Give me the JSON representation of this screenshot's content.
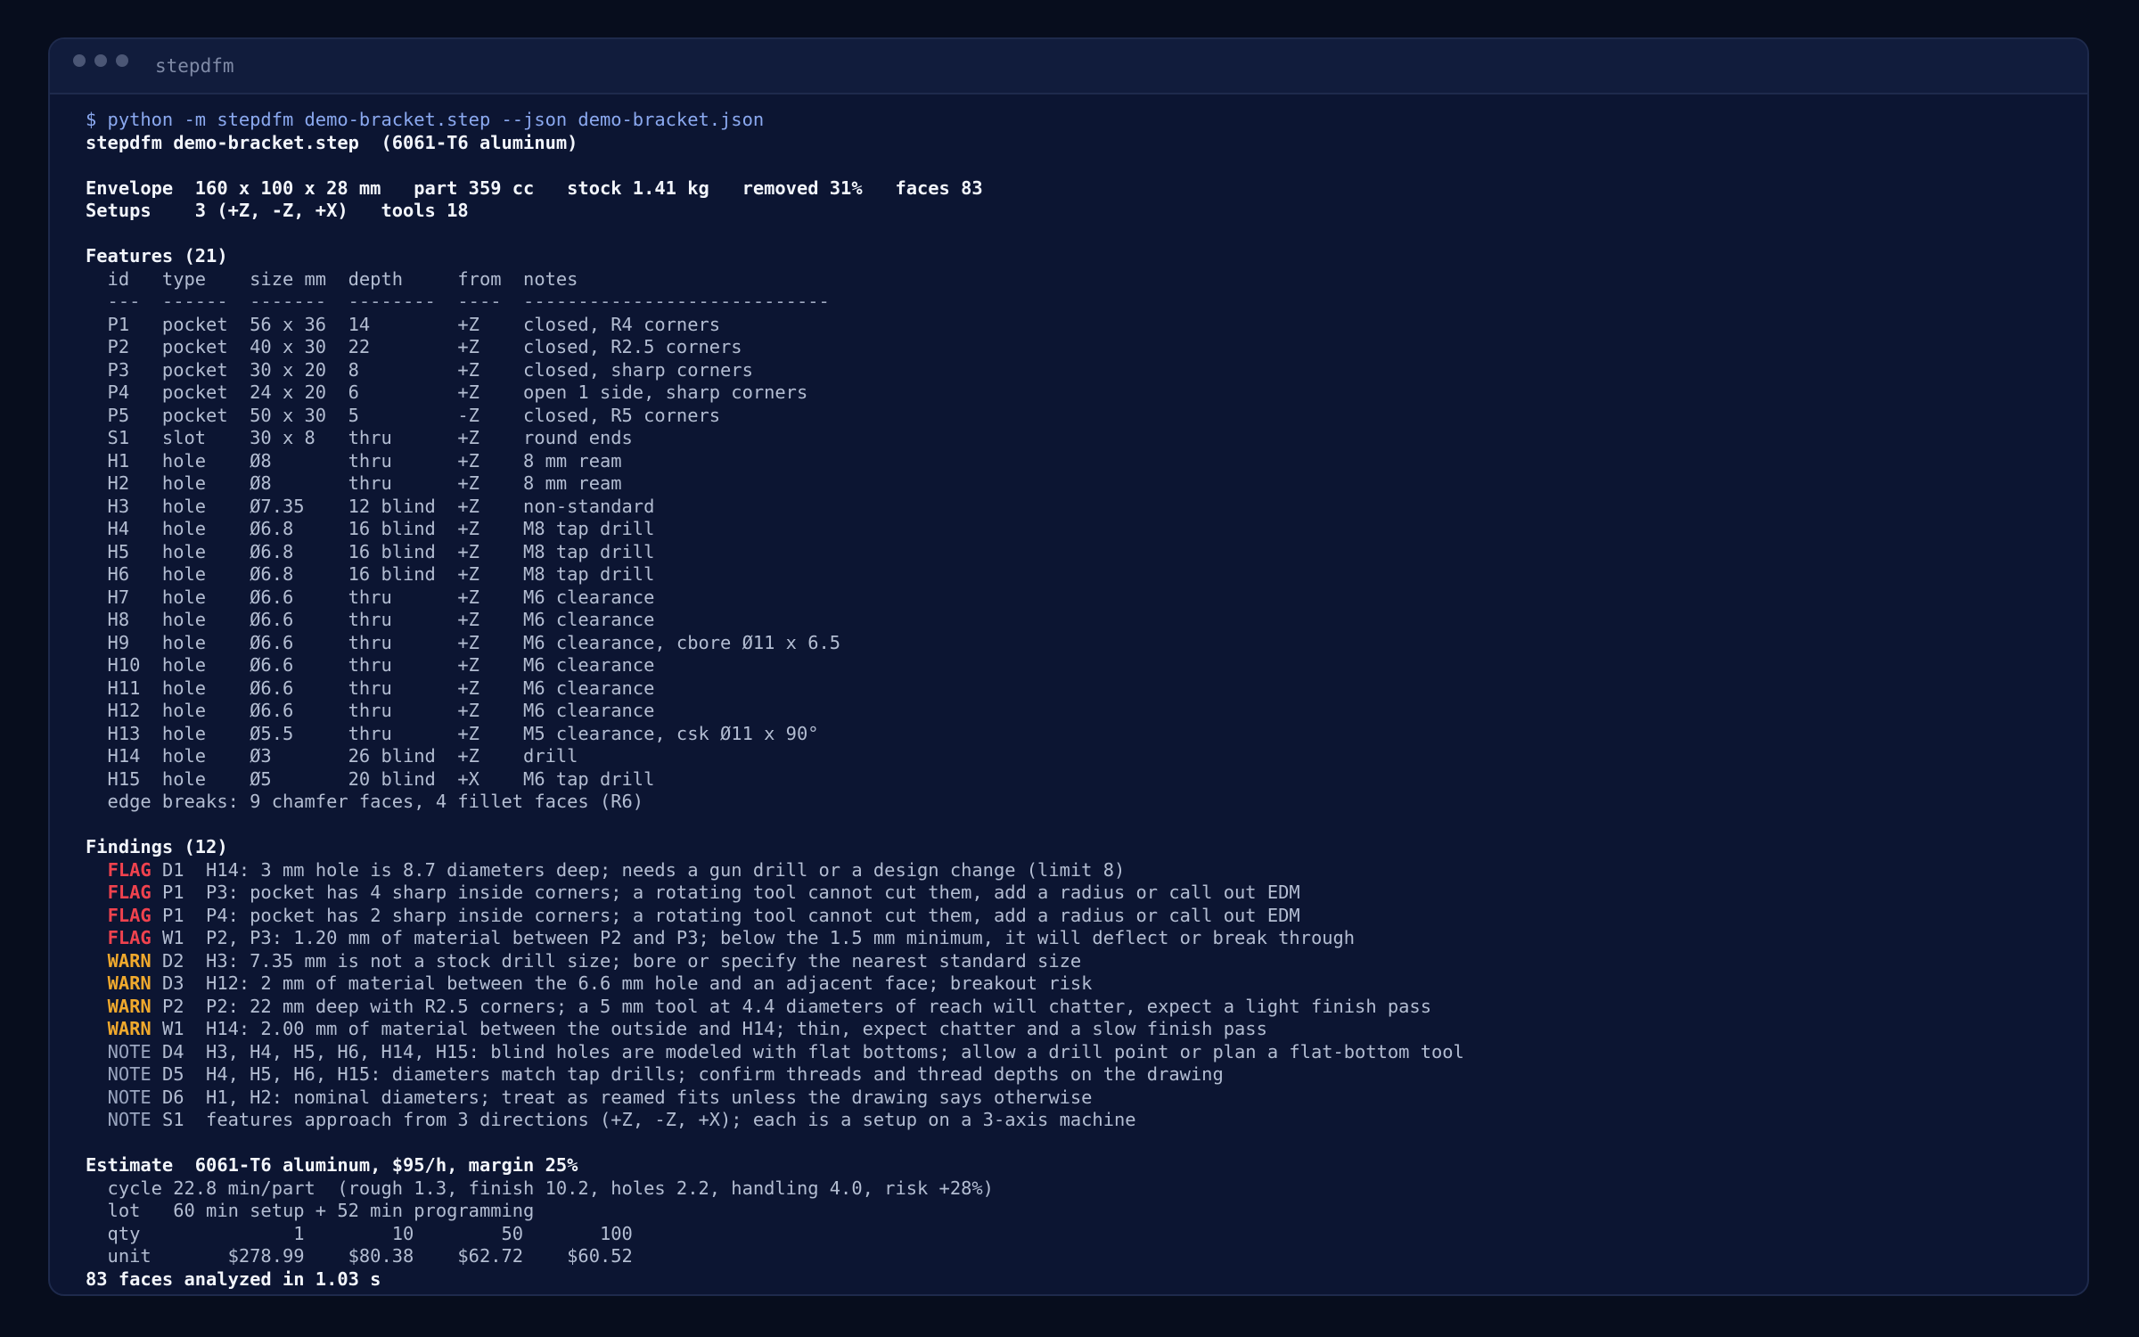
{
  "window": {
    "title": "stepdfm"
  },
  "colors": {
    "flag": "#f0424e",
    "warn": "#f0a92d",
    "note": "#9aa5bf",
    "command": "#8ba9f0"
  },
  "terminal": {
    "command": "$ python -m stepdfm demo-bracket.step --json demo-bracket.json",
    "header": "stepdfm demo-bracket.step  (6061-T6 aluminum)",
    "envelope": "Envelope  160 x 100 x 28 mm   part 359 cc   stock 1.41 kg   removed 31%   faces 83",
    "setups": "Setups    3 (+Z, -Z, +X)   tools 18",
    "features_title": "Features (21)",
    "features_header": "  id   type    size mm  depth     from  notes",
    "features_rule": "  ---  ------  -------  --------  ----  ----------------------------",
    "features": [
      "  P1   pocket  56 x 36  14        +Z    closed, R4 corners",
      "  P2   pocket  40 x 30  22        +Z    closed, R2.5 corners",
      "  P3   pocket  30 x 20  8         +Z    closed, sharp corners",
      "  P4   pocket  24 x 20  6         +Z    open 1 side, sharp corners",
      "  P5   pocket  50 x 30  5         -Z    closed, R5 corners",
      "  S1   slot    30 x 8   thru      +Z    round ends",
      "  H1   hole    Ø8       thru      +Z    8 mm ream",
      "  H2   hole    Ø8       thru      +Z    8 mm ream",
      "  H3   hole    Ø7.35    12 blind  +Z    non-standard",
      "  H4   hole    Ø6.8     16 blind  +Z    M8 tap drill",
      "  H5   hole    Ø6.8     16 blind  +Z    M8 tap drill",
      "  H6   hole    Ø6.8     16 blind  +Z    M8 tap drill",
      "  H7   hole    Ø6.6     thru      +Z    M6 clearance",
      "  H8   hole    Ø6.6     thru      +Z    M6 clearance",
      "  H9   hole    Ø6.6     thru      +Z    M6 clearance, cbore Ø11 x 6.5",
      "  H10  hole    Ø6.6     thru      +Z    M6 clearance",
      "  H11  hole    Ø6.6     thru      +Z    M6 clearance",
      "  H12  hole    Ø6.6     thru      +Z    M6 clearance",
      "  H13  hole    Ø5.5     thru      +Z    M5 clearance, csk Ø11 x 90°",
      "  H14  hole    Ø3       26 blind  +Z    drill",
      "  H15  hole    Ø5       20 blind  +X    M6 tap drill"
    ],
    "edge_breaks": "  edge breaks: 9 chamfer faces, 4 fillet faces (R6)",
    "findings_title": "Findings (12)",
    "findings": [
      {
        "level": "flag",
        "tag": "FLAG",
        "text": " D1  H14: 3 mm hole is 8.7 diameters deep; needs a gun drill or a design change (limit 8)"
      },
      {
        "level": "flag",
        "tag": "FLAG",
        "text": " P1  P3: pocket has 4 sharp inside corners; a rotating tool cannot cut them, add a radius or call out EDM"
      },
      {
        "level": "flag",
        "tag": "FLAG",
        "text": " P1  P4: pocket has 2 sharp inside corners; a rotating tool cannot cut them, add a radius or call out EDM"
      },
      {
        "level": "flag",
        "tag": "FLAG",
        "text": " W1  P2, P3: 1.20 mm of material between P2 and P3; below the 1.5 mm minimum, it will deflect or break through"
      },
      {
        "level": "warn",
        "tag": "WARN",
        "text": " D2  H3: 7.35 mm is not a stock drill size; bore or specify the nearest standard size"
      },
      {
        "level": "warn",
        "tag": "WARN",
        "text": " D3  H12: 2 mm of material between the 6.6 mm hole and an adjacent face; breakout risk"
      },
      {
        "level": "warn",
        "tag": "WARN",
        "text": " P2  P2: 22 mm deep with R2.5 corners; a 5 mm tool at 4.4 diameters of reach will chatter, expect a light finish pass"
      },
      {
        "level": "warn",
        "tag": "WARN",
        "text": " W1  H14: 2.00 mm of material between the outside and H14; thin, expect chatter and a slow finish pass"
      },
      {
        "level": "note",
        "tag": "NOTE",
        "text": " D4  H3, H4, H5, H6, H14, H15: blind holes are modeled with flat bottoms; allow a drill point or plan a flat-bottom tool"
      },
      {
        "level": "note",
        "tag": "NOTE",
        "text": " D5  H4, H5, H6, H15: diameters match tap drills; confirm threads and thread depths on the drawing"
      },
      {
        "level": "note",
        "tag": "NOTE",
        "text": " D6  H1, H2: nominal diameters; treat as reamed fits unless the drawing says otherwise"
      },
      {
        "level": "note",
        "tag": "NOTE",
        "text": " S1  features approach from 3 directions (+Z, -Z, +X); each is a setup on a 3-axis machine"
      }
    ],
    "estimate_title": "Estimate  6061-T6 aluminum, $95/h, margin 25%",
    "cycle": "  cycle 22.8 min/part  (rough 1.3, finish 10.2, holes 2.2, handling 4.0, risk +28%)",
    "lot": "  lot   60 min setup + 52 min programming",
    "qty_row": "  qty              1        10        50       100",
    "unit_row": "  unit       $278.99    $80.38    $62.72    $60.52",
    "footer": "83 faces analyzed in 1.03 s"
  }
}
